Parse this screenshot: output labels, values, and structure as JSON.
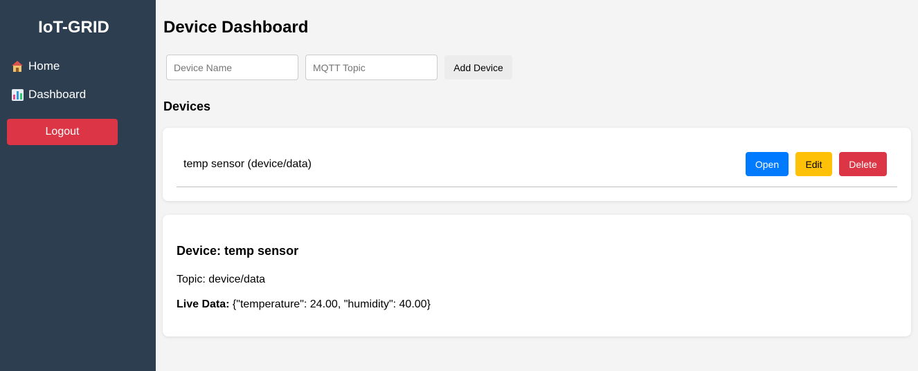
{
  "sidebar": {
    "brand": "IoT-GRID",
    "items": [
      {
        "label": "Home",
        "icon": "house-icon"
      },
      {
        "label": "Dashboard",
        "icon": "bar-chart-icon"
      }
    ],
    "logout_label": "Logout"
  },
  "main": {
    "title": "Device Dashboard",
    "form": {
      "device_name_placeholder": "Device Name",
      "mqtt_topic_placeholder": "MQTT Topic",
      "add_label": "Add Device"
    },
    "devices_heading": "Devices",
    "devices": [
      {
        "label": "temp sensor (device/data)",
        "open_label": "Open",
        "edit_label": "Edit",
        "delete_label": "Delete"
      }
    ],
    "detail": {
      "title": "Device: temp sensor",
      "topic": "Topic: device/data",
      "live_label": "Live Data:",
      "live_value": " {\"temperature\": 24.00, \"humidity\": 40.00}"
    }
  },
  "colors": {
    "sidebar_bg": "#2c3e50",
    "page_bg": "#f4f4f4",
    "danger": "#dc3545",
    "primary": "#007bff",
    "warning": "#ffc107"
  }
}
